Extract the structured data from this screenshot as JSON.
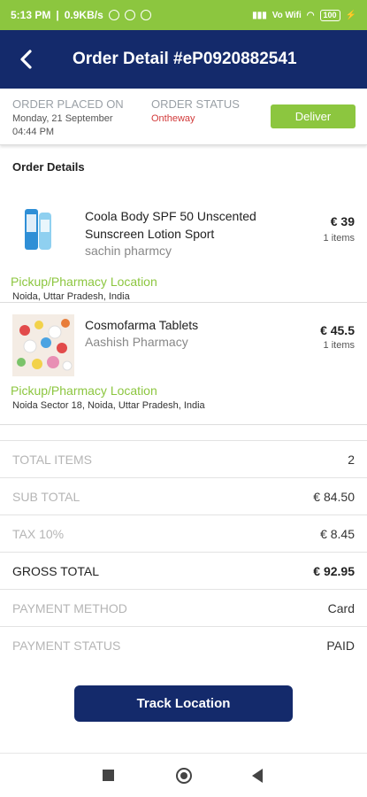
{
  "statusbar": {
    "time": "5:13 PM",
    "speed": "0.9KB/s",
    "network": "Vo Wifi",
    "battery": "100"
  },
  "header": {
    "title": "Order Detail #eP0920882541"
  },
  "meta": {
    "placed_label": "ORDER PLACED ON",
    "placed_date": "Monday, 21 September",
    "placed_time": "04:44 PM",
    "status_label": "ORDER STATUS",
    "status_value": "Ontheway",
    "deliver_label": "Deliver"
  },
  "order_details": {
    "heading": "Order Details",
    "items": [
      {
        "name": "Coola Body SPF 50 Unscented Sunscreen Lotion Sport",
        "pharmacy": "sachin pharmcy",
        "price": "€ 39",
        "qty": "1 items",
        "location_label": "Pickup/Pharmacy Location",
        "location": "Noida, Uttar Pradesh, India"
      },
      {
        "name": "Cosmofarma Tablets",
        "pharmacy": "Aashish Pharmacy",
        "price": "€ 45.5",
        "qty": "1 items",
        "location_label": "Pickup/Pharmacy Location",
        "location": "Noida Sector 18, Noida, Uttar Pradesh, India"
      }
    ]
  },
  "summary": [
    {
      "label": "TOTAL ITEMS",
      "value": "2"
    },
    {
      "label": "SUB TOTAL",
      "value": "€ 84.50"
    },
    {
      "label": "TAX 10%",
      "value": "€ 8.45"
    },
    {
      "label": "GROSS TOTAL",
      "value": "€ 92.95"
    },
    {
      "label": "PAYMENT METHOD",
      "value": "Card"
    },
    {
      "label": "PAYMENT STATUS",
      "value": "PAID"
    }
  ],
  "track_button": "Track Location",
  "colors": {
    "accent_green": "#8cc63f",
    "navy": "#142a6b",
    "status_red": "#d23a3a"
  }
}
